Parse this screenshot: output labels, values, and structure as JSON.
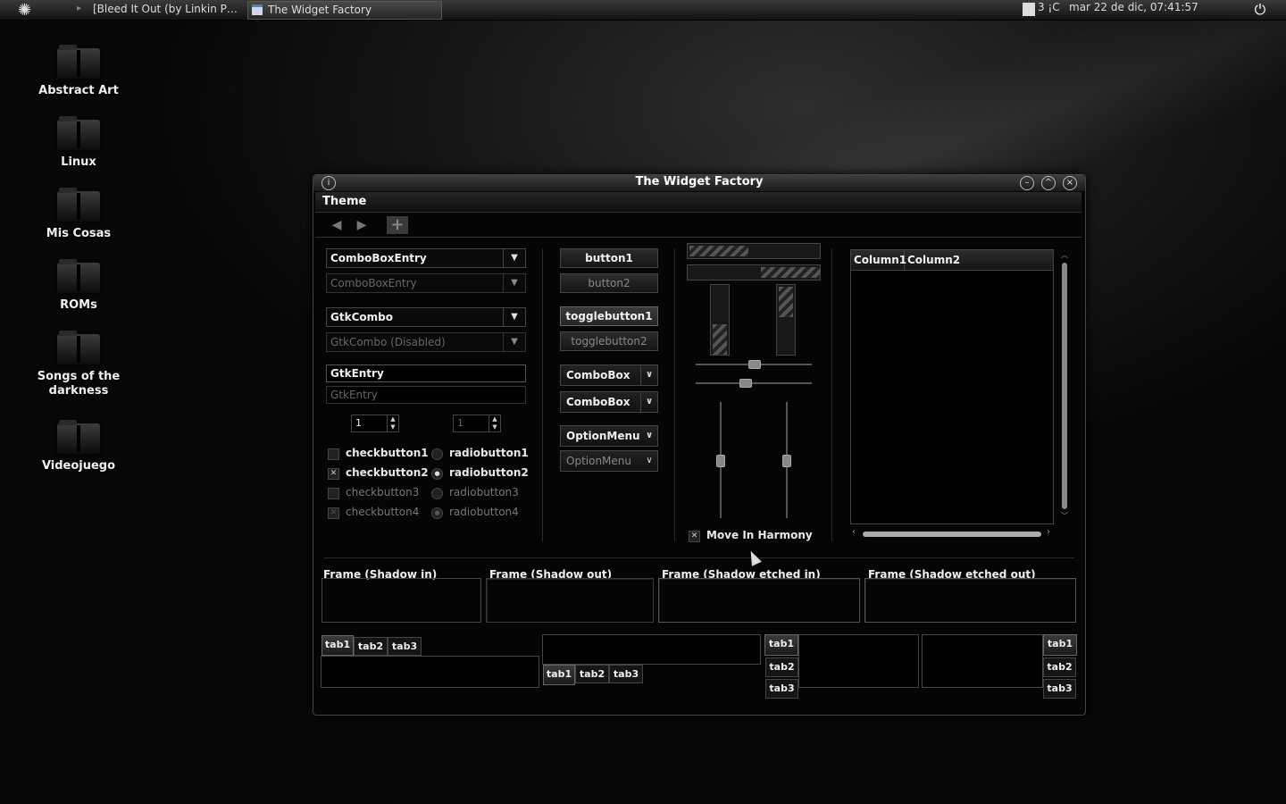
{
  "panel": {
    "tasks": [
      {
        "label": "[Bleed It Out (by Linkin P…",
        "active": false
      },
      {
        "label": "The Widget Factory",
        "active": true
      }
    ],
    "temperature": "3 ¡C",
    "clock": "mar 22 de dic, 07:41:57"
  },
  "desktop": {
    "icons": [
      {
        "label": "Abstract Art"
      },
      {
        "label": "Linux"
      },
      {
        "label": "Mis Cosas"
      },
      {
        "label": "ROMs"
      },
      {
        "label": "Songs of the darkness"
      },
      {
        "label": "Videojuego"
      }
    ]
  },
  "window": {
    "title": "The Widget Factory",
    "menu": {
      "theme": "Theme"
    },
    "col1": {
      "comboboxentry1": "ComboBoxEntry",
      "comboboxentry2": "ComboBoxEntry",
      "gtkcombo1": "GtkCombo",
      "gtkcombo2": "GtkCombo (Disabled)",
      "entry1": "GtkEntry",
      "entry2": "GtkEntry",
      "spin1": "1",
      "spin2": "1",
      "checks": [
        "checkbutton1",
        "checkbutton2",
        "checkbutton3",
        "checkbutton4"
      ],
      "radios": [
        "radiobutton1",
        "radiobutton2",
        "radiobutton3",
        "radiobutton4"
      ]
    },
    "col2": {
      "button1": "button1",
      "button2": "button2",
      "toggle1": "togglebutton1",
      "toggle2": "togglebutton2",
      "combobox1": "ComboBox",
      "combobox2": "ComboBox",
      "option1": "OptionMenu",
      "option2": "OptionMenu"
    },
    "col3": {
      "harmony": "Move In Harmony",
      "progress_top": 0.45,
      "progress_bottom_from": 0.55,
      "hslider1": 0.5,
      "hslider2": 0.42,
      "vslider1": 0.5,
      "vslider2": 0.5
    },
    "tree": {
      "columns": [
        "Column1",
        "Column2"
      ]
    },
    "frames": [
      "Frame (Shadow in)",
      "Frame (Shadow out)",
      "Frame (Shadow etched in)",
      "Frame (Shadow etched out)"
    ],
    "tabs": [
      "tab1",
      "tab2",
      "tab3"
    ]
  }
}
